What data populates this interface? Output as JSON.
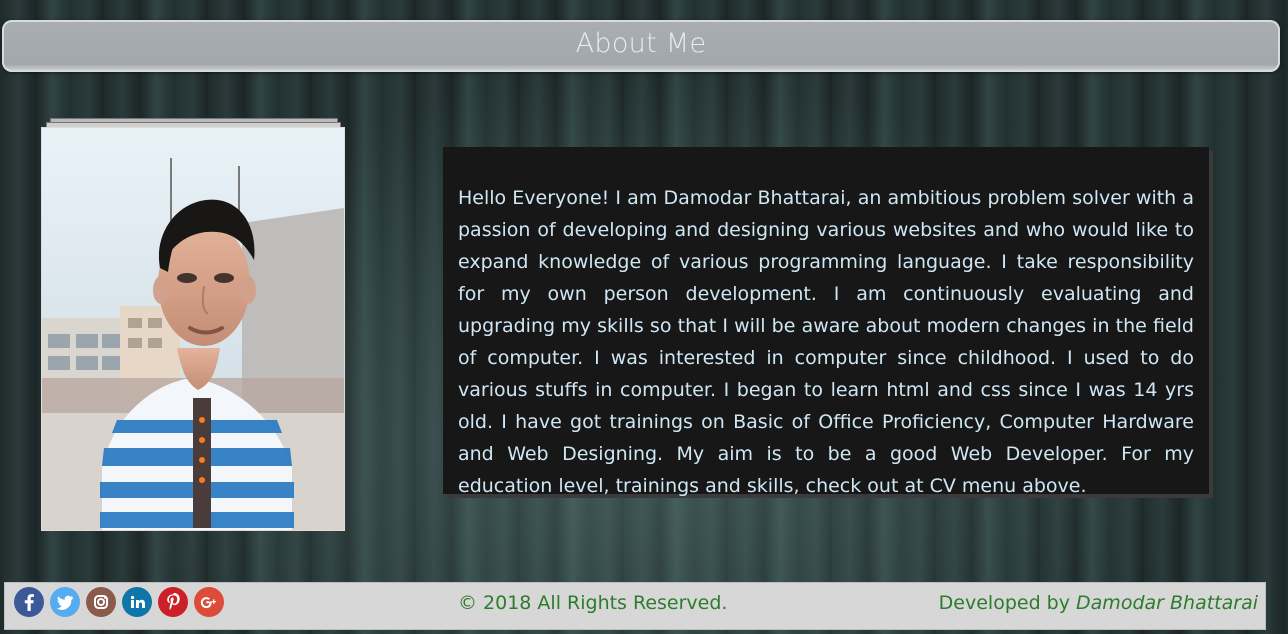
{
  "header": {
    "title": "About Me"
  },
  "main": {
    "about_text": "Hello Everyone! I am Damodar Bhattarai, an ambitious problem solver with a passion of developing and designing various websites and who would like to expand knowledge of various programming language. I take responsibility for my own person development. I am continuously evaluating and upgrading my skills so that I will be aware about modern changes in the field of computer. I was interested in computer since childhood. I used to do various stuffs in computer. I began to learn html and css since I was 14 yrs old. I have got trainings on Basic of Office Proficiency, Computer Hardware and Web Designing. My aim is to be a good Web Developer. For my education level, trainings and skills, check out at CV menu above."
  },
  "footer": {
    "social_links": [
      {
        "icon": "facebook-icon",
        "color": "#3b5998"
      },
      {
        "icon": "twitter-icon",
        "color": "#55acee"
      },
      {
        "icon": "instagram-icon",
        "color": "#8a5a4a"
      },
      {
        "icon": "linkedin-icon",
        "color": "#0e76a8"
      },
      {
        "icon": "pinterest-icon",
        "color": "#cb2027"
      },
      {
        "icon": "google-plus-icon",
        "color": "#dd4b39"
      }
    ],
    "copyright": "© 2018 All Rights Reserved.",
    "developed_by_label": "Developed by",
    "developer_name": "Damodar Bhattarai",
    "accent_color": "#2c7c2c"
  }
}
